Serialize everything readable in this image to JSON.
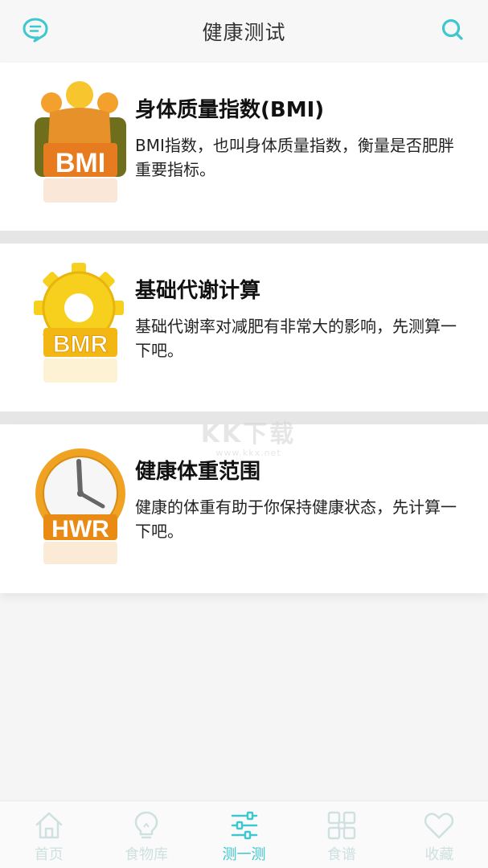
{
  "header": {
    "title": "健康测试",
    "left_icon": "chat-bubble-icon",
    "right_icon": "search-icon"
  },
  "cards": [
    {
      "badge": "BMI",
      "title": "身体质量指数(BMI)",
      "desc": "BMI指数，也叫身体质量指数，衡量是否肥胖重要指标。"
    },
    {
      "badge": "BMR",
      "title": "基础代谢计算",
      "desc": "基础代谢率对减肥有非常大的影响，先测算一下吧。"
    },
    {
      "badge": "HWR",
      "title": "健康体重范围",
      "desc": "健康的体重有助于你保持健康状态，先计算一下吧。"
    }
  ],
  "watermark": {
    "main": "KK下载",
    "sub": "www.kkx.net"
  },
  "tabs": [
    {
      "label": "首页",
      "icon": "home-icon",
      "active": false
    },
    {
      "label": "食物库",
      "icon": "lightbulb-icon",
      "active": false
    },
    {
      "label": "测一测",
      "icon": "sliders-icon",
      "active": true
    },
    {
      "label": "食谱",
      "icon": "grid-icon",
      "active": false
    },
    {
      "label": "收藏",
      "icon": "heart-icon",
      "active": false
    }
  ],
  "colors": {
    "accent": "#3ec7cf",
    "tab_inactive": "#cfe0e0",
    "bmi_orange": "#f3a12c",
    "bmr_yellow": "#f7cf1d",
    "hwr_orange": "#f0a323"
  }
}
